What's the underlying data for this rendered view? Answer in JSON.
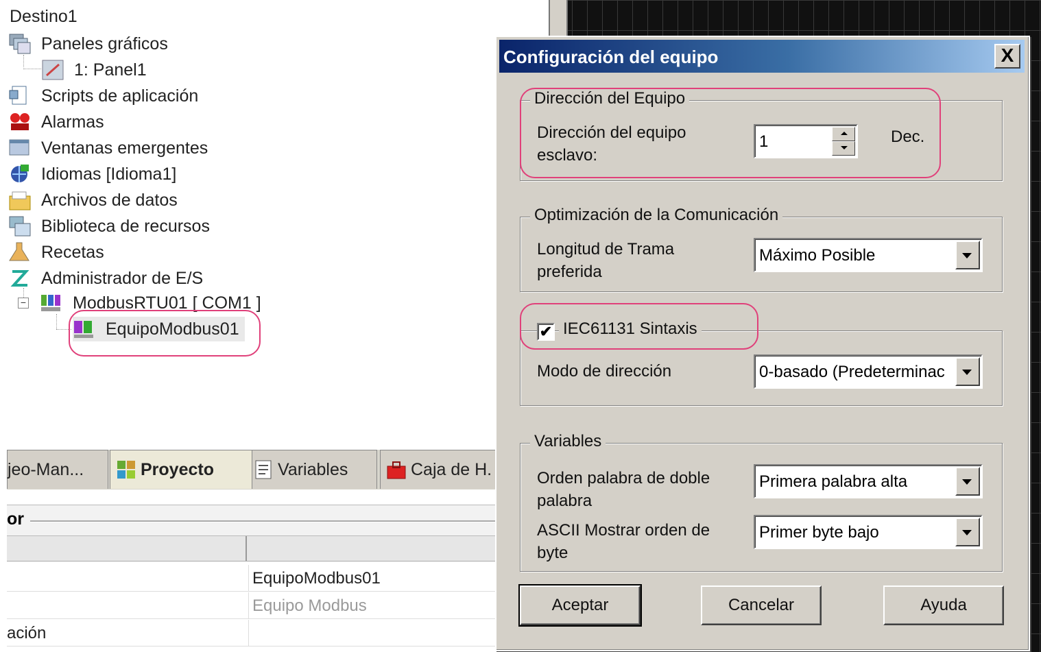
{
  "tree": {
    "root": "Destino1",
    "items": [
      {
        "label": "Paneles gráficos",
        "icon": "graphic-panels-icon"
      },
      {
        "label": "1: Panel1",
        "icon": "panel-icon"
      },
      {
        "label": "Scripts de aplicación",
        "icon": "scripts-icon"
      },
      {
        "label": "Alarmas",
        "icon": "alarm-icon"
      },
      {
        "label": "Ventanas emergentes",
        "icon": "popup-window-icon"
      },
      {
        "label": "Idiomas [Idioma1]",
        "icon": "languages-icon"
      },
      {
        "label": "Archivos de datos",
        "icon": "data-files-icon"
      },
      {
        "label": "Biblioteca de recursos",
        "icon": "resource-library-icon"
      },
      {
        "label": "Recetas",
        "icon": "recipes-icon"
      },
      {
        "label": "Administrador de E/S",
        "icon": "io-manager-icon"
      },
      {
        "label": "ModbusRTU01 [ COM1 ]",
        "icon": "modbus-driver-icon"
      },
      {
        "label": "EquipoModbus01",
        "icon": "modbus-equipment-icon"
      }
    ]
  },
  "tabs": [
    {
      "label": "jeo-Man..."
    },
    {
      "label": "Proyecto"
    },
    {
      "label": "Variables"
    },
    {
      "label": "Caja de H."
    }
  ],
  "properties": {
    "header": "or",
    "rows": [
      {
        "key": "",
        "value": "EquipoModbus01",
        "gray": false
      },
      {
        "key": "",
        "value": "Equipo Modbus",
        "gray": true
      },
      {
        "key": "ación",
        "value": "",
        "gray": false
      }
    ]
  },
  "dialog": {
    "title": "Configuración del equipo",
    "close": "X",
    "group_address": {
      "legend": "Dirección del Equipo",
      "label": "Dirección del equipo esclavo:",
      "value": "1",
      "unit": "Dec."
    },
    "group_comm": {
      "legend": "Optimización de la Comunicación",
      "label": "Longitud de Trama preferida",
      "value": "Máximo Posible"
    },
    "group_iec": {
      "legend": "IEC61131 Sintaxis",
      "checked": "✔",
      "label": "Modo de dirección",
      "value": "0-basado (Predeterminac"
    },
    "group_vars": {
      "legend": "Variables",
      "label1": "Orden palabra de doble palabra",
      "value1": "Primera palabra alta",
      "label2": "ASCII Mostrar orden de byte",
      "value2": "Primer byte bajo"
    },
    "buttons": {
      "ok": "Aceptar",
      "cancel": "Cancelar",
      "help": "Ayuda"
    }
  },
  "colors": {
    "titlebar_start": "#0a246a",
    "titlebar_end": "#a6caf0",
    "highlight": "#e0407a",
    "dialog_bg": "#d4d0c8"
  }
}
